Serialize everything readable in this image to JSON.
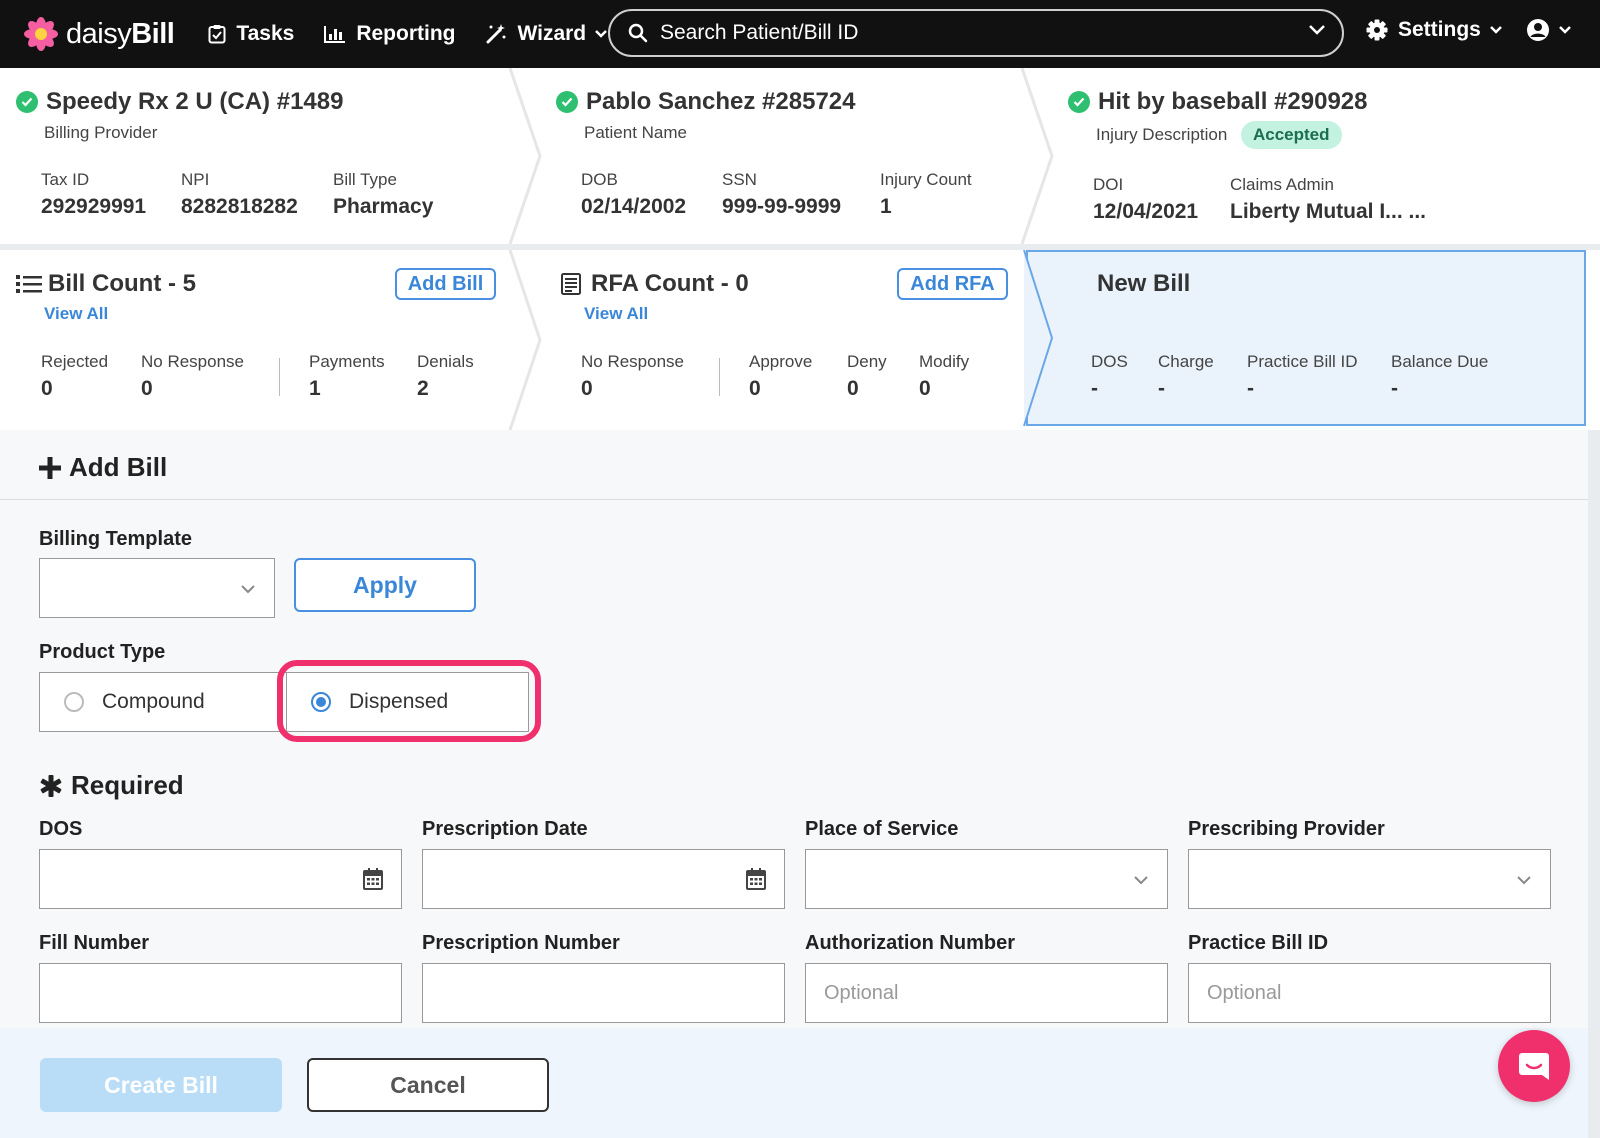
{
  "nav": {
    "logo_text_light": "daisy",
    "logo_text_bold": "Bill",
    "tasks": "Tasks",
    "reporting": "Reporting",
    "wizard": "Wizard",
    "search_placeholder": "Search Patient/Bill ID",
    "settings": "Settings"
  },
  "provider": {
    "title": "Speedy Rx 2 U (CA) #1489",
    "subtitle": "Billing Provider",
    "tax_id_label": "Tax ID",
    "tax_id": "292929991",
    "npi_label": "NPI",
    "npi": "8282818282",
    "bill_type_label": "Bill Type",
    "bill_type": "Pharmacy"
  },
  "patient": {
    "title": "Pablo Sanchez #285724",
    "subtitle": "Patient Name",
    "dob_label": "DOB",
    "dob": "02/14/2002",
    "ssn_label": "SSN",
    "ssn": "999-99-9999",
    "injury_count_label": "Injury Count",
    "injury_count": "1"
  },
  "injury": {
    "title": "Hit by baseball #290928",
    "subtitle": "Injury Description",
    "status": "Accepted",
    "doi_label": "DOI",
    "doi": "12/04/2021",
    "claims_admin_label": "Claims Admin",
    "claims_admin": "Liberty Mutual I... ..."
  },
  "bills": {
    "title": "Bill Count - 5",
    "view_all": "View All",
    "add_label": "Add Bill",
    "stats": [
      {
        "label": "Rejected",
        "value": "0"
      },
      {
        "label": "No Response",
        "value": "0"
      },
      {
        "label": "Payments",
        "value": "1"
      },
      {
        "label": "Denials",
        "value": "2"
      }
    ]
  },
  "rfa": {
    "title": "RFA Count - 0",
    "view_all": "View All",
    "add_label": "Add RFA",
    "stats": [
      {
        "label": "No Response",
        "value": "0"
      },
      {
        "label": "Approve",
        "value": "0"
      },
      {
        "label": "Deny",
        "value": "0"
      },
      {
        "label": "Modify",
        "value": "0"
      }
    ]
  },
  "new_bill": {
    "title": "New Bill",
    "stats": [
      {
        "label": "DOS",
        "value": "-"
      },
      {
        "label": "Charge",
        "value": "-"
      },
      {
        "label": "Practice Bill ID",
        "value": "-"
      },
      {
        "label": "Balance Due",
        "value": "-"
      }
    ]
  },
  "form": {
    "section_title": "Add Bill",
    "billing_template_label": "Billing Template",
    "apply_label": "Apply",
    "product_type_label": "Product Type",
    "product_options": [
      "Compound",
      "Dispensed"
    ],
    "product_selected": "Dispensed",
    "required_title": "Required",
    "fields": {
      "dos": "DOS",
      "prescription_date": "Prescription Date",
      "place_of_service": "Place of Service",
      "prescribing_provider": "Prescribing Provider",
      "fill_number": "Fill Number",
      "prescription_number": "Prescription Number",
      "authorization_number": "Authorization Number",
      "practice_bill_id": "Practice Bill ID"
    },
    "optional_placeholder": "Optional"
  },
  "footer": {
    "create_label": "Create Bill",
    "cancel_label": "Cancel"
  },
  "colors": {
    "accent": "#3a86d8",
    "success": "#2fbf71",
    "highlight": "#f0306c"
  }
}
